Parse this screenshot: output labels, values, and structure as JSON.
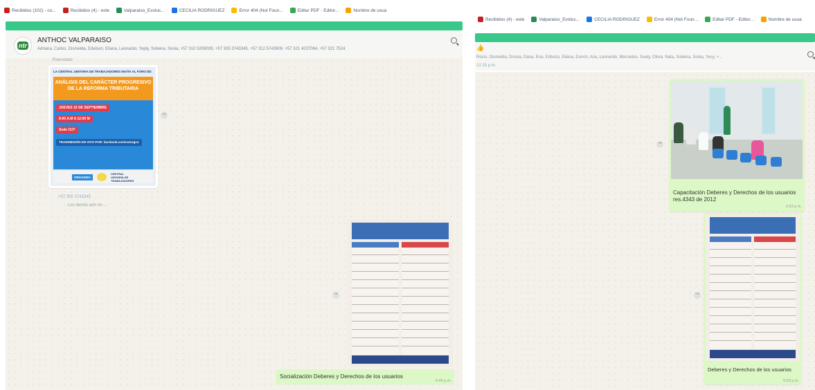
{
  "left": {
    "bookmarks": [
      {
        "label": "Recibidos (102) - co...",
        "icon": "gmail-icon",
        "color": "#c5221f"
      },
      {
        "label": "Recibidos (4) - este",
        "icon": "gmail-icon",
        "color": "#c5221f"
      },
      {
        "label": "Valparaiso_Evoluc...",
        "icon": "globe-icon",
        "color": "#2a8a5a"
      },
      {
        "label": "CECILIA RODRIGUEZ",
        "icon": "contact-icon",
        "color": "#1a73e8"
      },
      {
        "label": "Error 404 (Not Foun...",
        "icon": "google-icon",
        "color": "#fbbc04"
      },
      {
        "label": "Editar PDF - Editor...",
        "icon": "pdf-icon",
        "color": "#34a853"
      },
      {
        "label": "Nombre de usua",
        "icon": "key-icon",
        "color": "#f4a300"
      }
    ],
    "header": {
      "title": "ANTHOC VALPARAISO",
      "members": "Adriana, Carlos, Dismelda, Edelson, Eliana, Leonardo, Yeply, Sobeira, Sonia, +57 310 5209039, +57 305 3743345, +57 312 5743909, +57 321 4237064, +57 321 7524"
    },
    "messages": {
      "forwarded": "Reenviado",
      "poster": {
        "top": "LA CENTRAL UNITARIA DE TRABAJADORES INVITA AL FORO DE:",
        "title": "ANÁLISIS DEL CARÁCTER PROGRESIVO DE LA REFORMA TRIBUTARIA",
        "date": "JUEVES 16 DE SEPTIEMBRE",
        "time": "8:00 A.M A 12:00 M",
        "place": "Sede CUT",
        "stream": "TRANSMISIÓN EN VIVO POR: facebook.com/cutorgco",
        "org": "ORGANIZA",
        "cut": "CENTRAL UNITARIA DE TRABAJADORES"
      },
      "sender": "+57 305 3743345",
      "subtext": "Los demás aún no ...",
      "leaflet_caption": "Socialización Deberes y Derechos de los usuarios",
      "leaflet_time": "6:40 p.m."
    }
  },
  "right": {
    "bookmarks": [
      {
        "label": "Recibidos (4) - este",
        "icon": "gmail-icon",
        "color": "#c5221f"
      },
      {
        "label": "Valparaiso_Evoluc...",
        "icon": "globe-icon",
        "color": "#2a8a5a"
      },
      {
        "label": "CECILIA RODRIGUEZ",
        "icon": "contact-icon",
        "color": "#1a73e8"
      },
      {
        "label": "Error 404 (Not Foun...",
        "icon": "google-icon",
        "color": "#fbbc04"
      },
      {
        "label": "Editar PDF - Editor...",
        "icon": "pdf-icon",
        "color": "#34a853"
      },
      {
        "label": "Nombre de usua",
        "icon": "key-icon",
        "color": "#f4a300"
      }
    ],
    "header": {
      "members": "Rocio, Dismelda, Drosía, Dana, Ena, Eribuzu, Eliana, Dunch, Ana, Leonardo, Mercedes, Suely, Olivia, Nata, Sobeira, Sonia, Yecy, +...",
      "time": "12:15 p.m."
    },
    "messages": {
      "photo_caption": "Capacitación Deberes y Derechos de los usuarios res.4343 de 2012",
      "photo_time": "6:53 p.m.",
      "leaflet_caption": "Deberes y Derechos de los usuarios",
      "leaflet_time": "6:53 p.m."
    }
  },
  "colors": {
    "accent": "#37c88a",
    "bubble_out": "#dcf8c6",
    "chat_bg": "#f3f1ea"
  }
}
